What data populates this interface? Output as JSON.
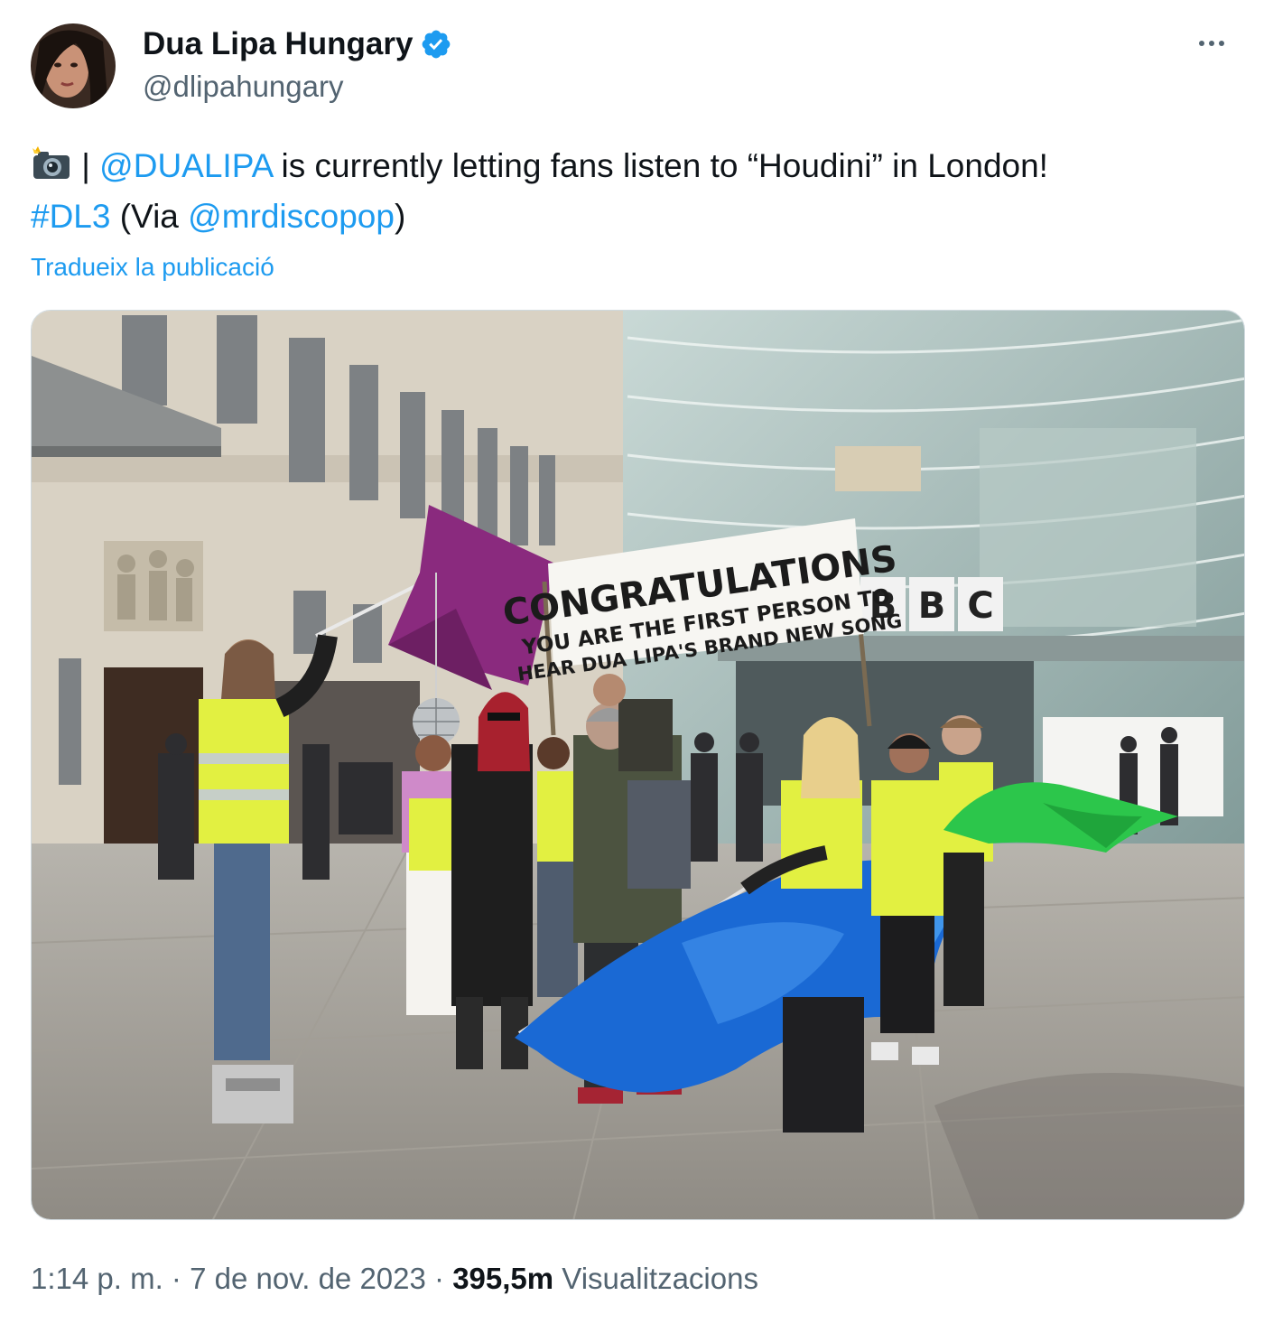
{
  "author": {
    "name": "Dua Lipa Hungary",
    "handle": "@dlipahungary",
    "verified_color": "#1d9bf0"
  },
  "more_icon": "more-horizontal-icon",
  "tweet": {
    "emoji_icon": "camera-with-flash-icon",
    "separator": " | ",
    "mention_1": "@DUALIPA",
    "text_1": " is currently letting fans listen to “Houdini” in London!",
    "hashtag": "#DL3",
    "text_2": " (Via ",
    "mention_2": "@mrdiscopop",
    "text_3": ")",
    "translate": "Tradueix la publicació"
  },
  "media": {
    "banner": {
      "line1": "CONGRATULATIONS",
      "line2": "YOU ARE THE FIRST PERSON TO",
      "line3": "HEAR DUA LIPA'S BRAND NEW SONG"
    },
    "building_sign": "BBC"
  },
  "meta": {
    "time": "1:14 p. m.",
    "dot1": " · ",
    "date": "7 de nov. de 2023",
    "dot2": " · ",
    "views_count": "395,5m",
    "views_label": "Visualitzacions"
  },
  "colors": {
    "link": "#1d9bf0",
    "secondary": "#536471",
    "primary": "#0f1419"
  }
}
